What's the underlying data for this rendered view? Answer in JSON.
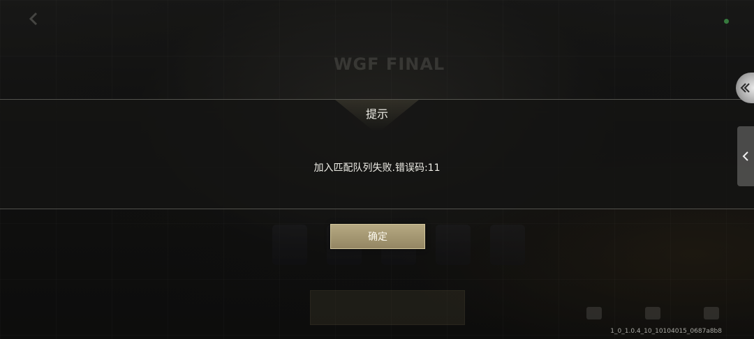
{
  "dialog": {
    "title": "提示",
    "message": "加入匹配队列失败.错误码:11",
    "confirm_label": "确定"
  },
  "background": {
    "title": "WGF FINAL"
  },
  "version": "1_0_1.0.4_10_10104015_0687a8b8",
  "icons": {
    "back": "back-arrow-icon",
    "side_toggle": "double-chevron-left-icon",
    "side_panel": "chevron-left-icon",
    "status": "online-status-dot"
  },
  "colors": {
    "confirm_button": "#a89b74",
    "status_dot": "#5ed36b"
  }
}
